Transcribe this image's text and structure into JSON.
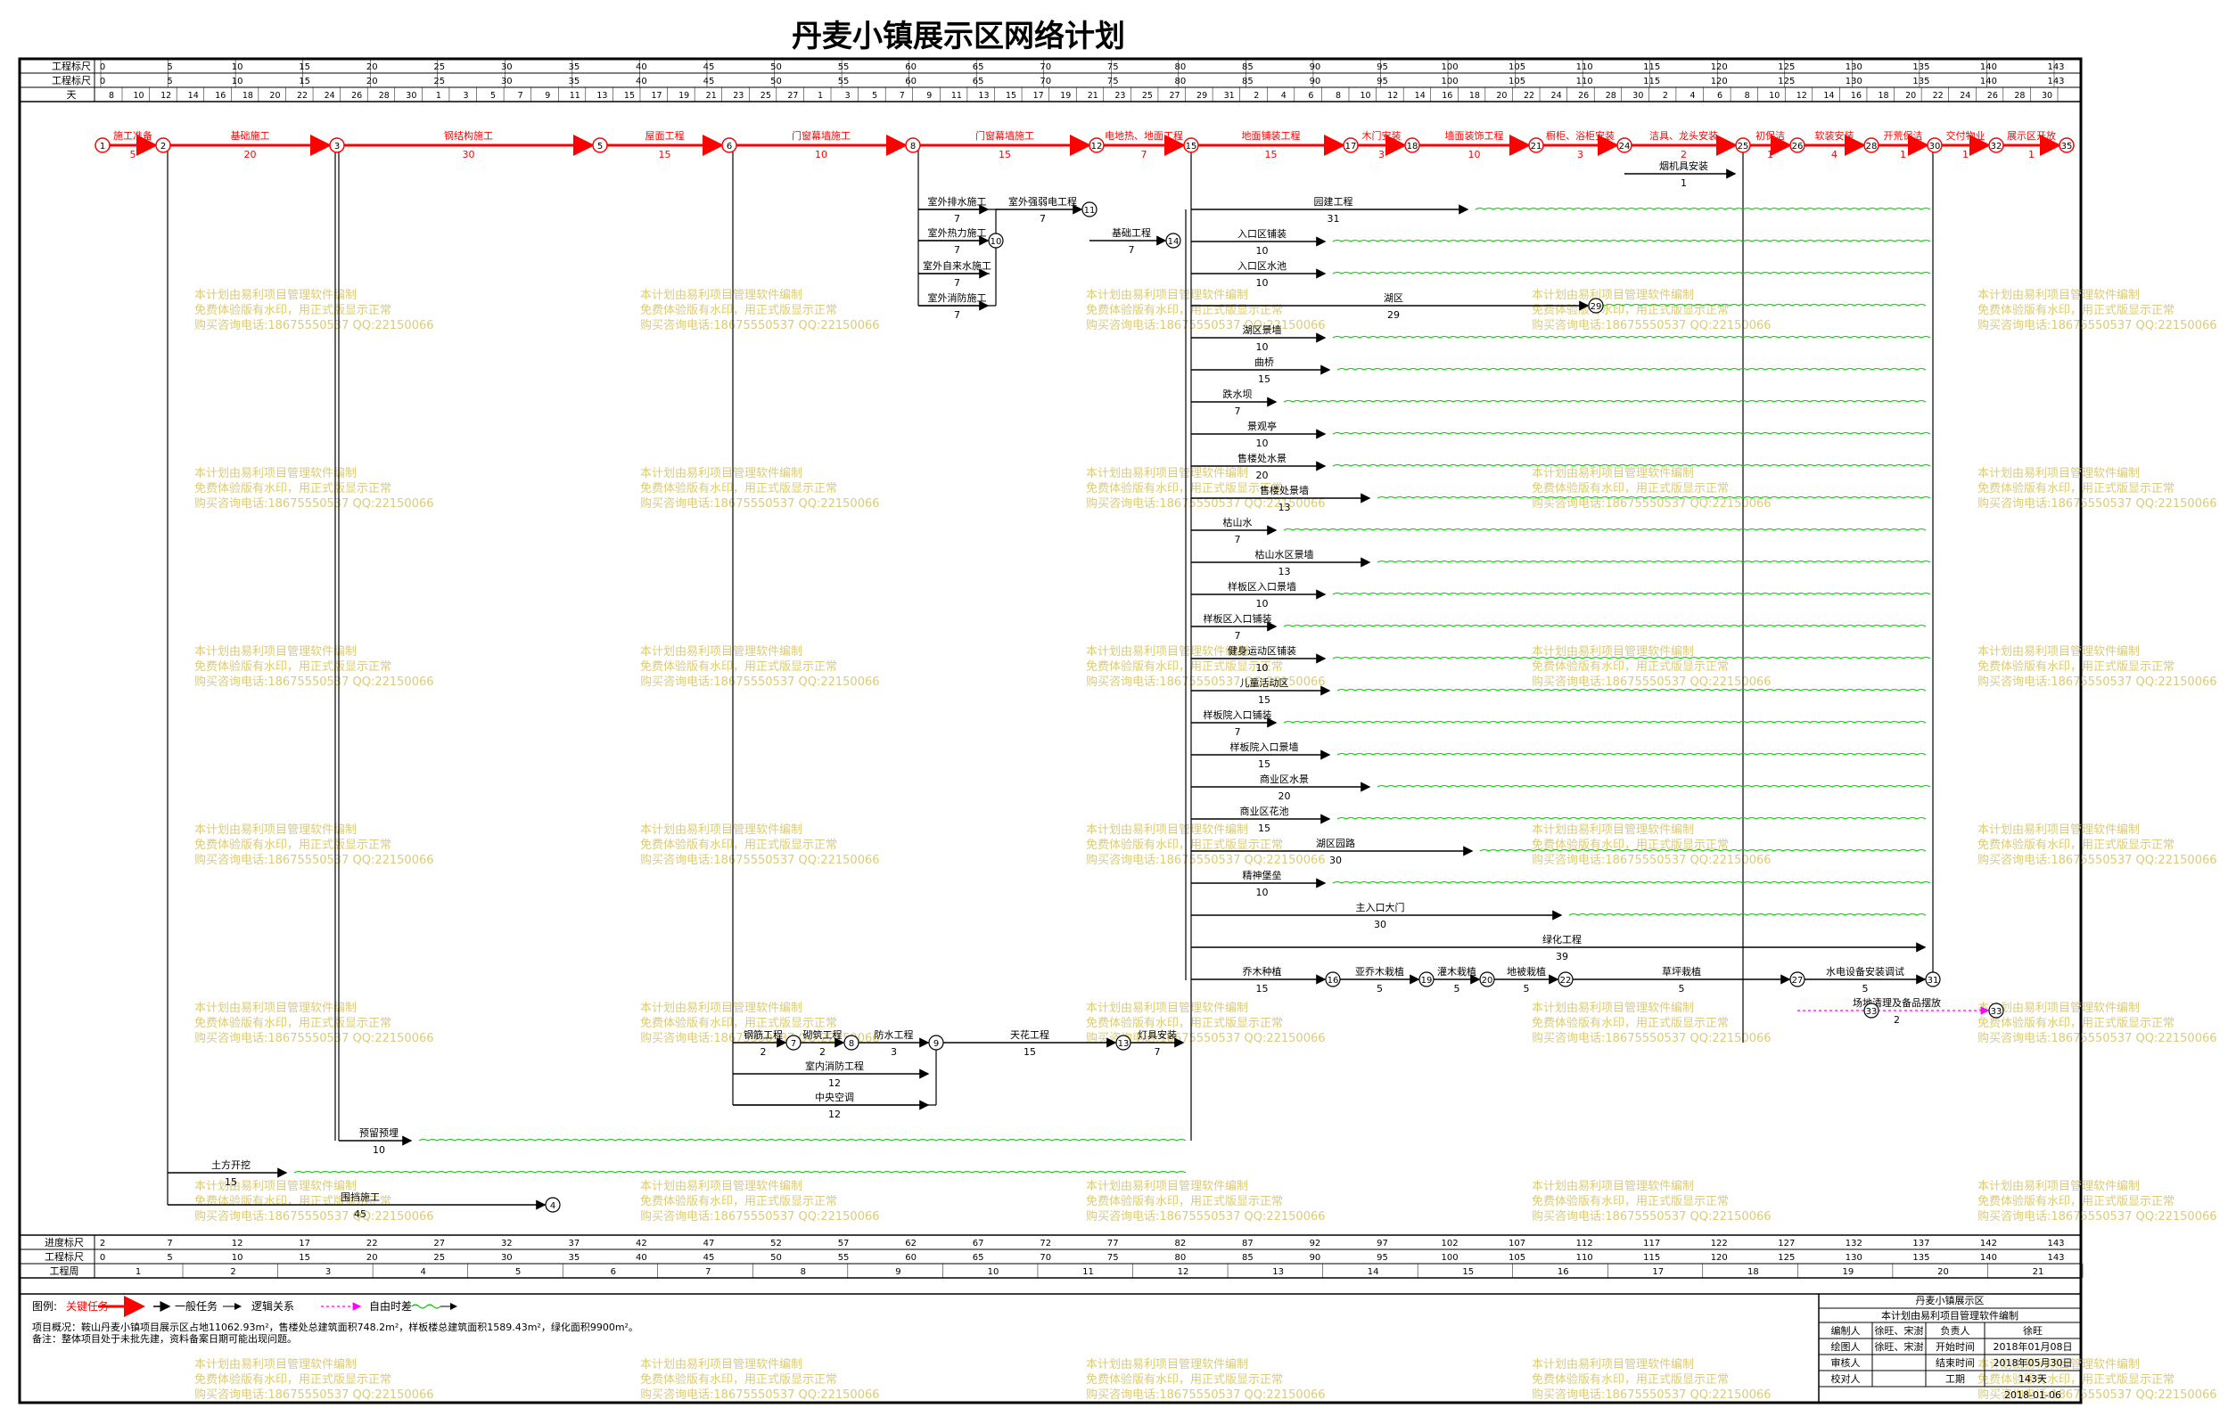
{
  "title": "丹麦小镇展示区网络计划",
  "ruler": {
    "top_row1_label": "工程标尺",
    "top_row2_label": "工程标尺",
    "top_row3_label": "天",
    "bottom_row1_label": "进度标尺",
    "bottom_row2_label": "工程标尺",
    "bottom_row3_label": "工程周",
    "ticks_top": [
      "0",
      "5",
      "10",
      "15",
      "20",
      "25",
      "30",
      "35",
      "40",
      "45",
      "50",
      "55",
      "60",
      "65",
      "70",
      "75",
      "80",
      "85",
      "90",
      "95",
      "100",
      "105",
      "110",
      "115",
      "120",
      "125",
      "130",
      "135",
      "140",
      "143"
    ],
    "days": [
      "8",
      "10",
      "12",
      "14",
      "16",
      "18",
      "20",
      "22",
      "24",
      "26",
      "28",
      "30",
      "1",
      "3",
      "5",
      "7",
      "9",
      "11",
      "13",
      "15",
      "17",
      "19",
      "21",
      "23",
      "25",
      "27",
      "1",
      "3",
      "5",
      "7",
      "9",
      "11",
      "13",
      "15",
      "17",
      "19",
      "21",
      "23",
      "25",
      "27",
      "29",
      "31",
      "2",
      "4",
      "6",
      "8",
      "10",
      "12",
      "14",
      "16",
      "18",
      "20",
      "22",
      "24",
      "26",
      "28",
      "30",
      "2",
      "4",
      "6",
      "8",
      "10",
      "12",
      "14",
      "16",
      "18",
      "20",
      "22",
      "24",
      "26",
      "28",
      "30"
    ],
    "bottom_ticks": [
      "2",
      "7",
      "12",
      "17",
      "22",
      "27",
      "32",
      "37",
      "42",
      "47",
      "52",
      "57",
      "62",
      "67",
      "72",
      "77",
      "82",
      "87",
      "92",
      "97",
      "102",
      "107",
      "112",
      "117",
      "122",
      "127",
      "132",
      "137",
      "142",
      "143"
    ],
    "weeks": [
      "1",
      "2",
      "3",
      "4",
      "5",
      "6",
      "7",
      "8",
      "9",
      "10",
      "11",
      "12",
      "13",
      "14",
      "15",
      "16",
      "17",
      "18",
      "19",
      "20",
      "21"
    ]
  },
  "critical_path": [
    {
      "node": "1",
      "label": "施工准备",
      "dur": "5"
    },
    {
      "node": "2",
      "label": "基础施工",
      "dur": "20"
    },
    {
      "node": "3",
      "label": "钢结构施工",
      "dur": "30"
    },
    {
      "node": "5",
      "label": "屋面工程",
      "dur": "15"
    },
    {
      "node": "6",
      "label": "门窗幕墙施工",
      "dur": "10"
    },
    {
      "node": "8",
      "label": "门窗幕墙施工",
      "dur": "15"
    },
    {
      "node": "12",
      "label": "电地热、地面工程",
      "dur": "7"
    },
    {
      "node": "15",
      "label": "地面铺装工程",
      "dur": "15"
    },
    {
      "node": "17",
      "label": "木门安装",
      "dur": "3"
    },
    {
      "node": "18",
      "label": "墙面装饰工程",
      "dur": "10"
    },
    {
      "node": "21",
      "label": "橱柜、浴柜安装",
      "dur": "3"
    },
    {
      "node": "24",
      "label": "洁具、龙头安装",
      "dur": "2"
    },
    {
      "node": "25",
      "label": "初保洁",
      "dur": "1"
    },
    {
      "node": "26",
      "label": "软装安装",
      "dur": "4"
    },
    {
      "node": "28",
      "label": "开荒保洁",
      "dur": "1"
    },
    {
      "node": "30",
      "label": "交付物业",
      "dur": "1"
    },
    {
      "node": "32",
      "label": "展示区开放",
      "dur": "1"
    },
    {
      "node": "35",
      "label": "",
      "dur": ""
    }
  ],
  "tasks": [
    {
      "label": "烟机具安装",
      "dur": "1"
    },
    {
      "label": "室外排水施工",
      "dur": "7"
    },
    {
      "label": "室外热力施工",
      "dur": "7"
    },
    {
      "label": "室外自来水施工",
      "dur": "7"
    },
    {
      "label": "室外消防施工",
      "dur": "7"
    },
    {
      "label": "室外强弱电工程",
      "dur": "7"
    },
    {
      "label": "基础工程",
      "dur": "7"
    },
    {
      "label": "园建工程",
      "dur": "31"
    },
    {
      "label": "入口区铺装",
      "dur": "10"
    },
    {
      "label": "入口区水池",
      "dur": "10"
    },
    {
      "label": "湖区",
      "dur": "29"
    },
    {
      "label": "湖区景墙",
      "dur": "10"
    },
    {
      "label": "曲桥",
      "dur": "15"
    },
    {
      "label": "跌水坝",
      "dur": "7"
    },
    {
      "label": "景观亭",
      "dur": "10"
    },
    {
      "label": "售楼处水景",
      "dur": "20"
    },
    {
      "label": "售楼处景墙",
      "dur": "13"
    },
    {
      "label": "枯山水",
      "dur": "7"
    },
    {
      "label": "枯山水区景墙",
      "dur": "13"
    },
    {
      "label": "样板区入口景墙",
      "dur": "10"
    },
    {
      "label": "样板区入口铺装",
      "dur": "7"
    },
    {
      "label": "健身运动区铺装",
      "dur": "10"
    },
    {
      "label": "儿童活动区",
      "dur": "15"
    },
    {
      "label": "样板院入口铺装",
      "dur": "7"
    },
    {
      "label": "样板院入口景墙",
      "dur": "15"
    },
    {
      "label": "商业区水景",
      "dur": "20"
    },
    {
      "label": "商业区花池",
      "dur": "15"
    },
    {
      "label": "湖区园路",
      "dur": "30"
    },
    {
      "label": "精神堡垒",
      "dur": "10"
    },
    {
      "label": "主入口大门",
      "dur": "30"
    },
    {
      "label": "绿化工程",
      "dur": "39"
    },
    {
      "label": "乔木种植",
      "dur": "15"
    },
    {
      "label": "亚乔木栽植",
      "dur": "5"
    },
    {
      "label": "灌木栽植",
      "dur": "5"
    },
    {
      "label": "地被栽植",
      "dur": "5"
    },
    {
      "label": "草坪栽植",
      "dur": "5"
    },
    {
      "label": "水电设备安装调试",
      "dur": "5"
    },
    {
      "label": "场地清理及备品摆放",
      "dur": "2"
    },
    {
      "label": "钢筋工程",
      "dur": "2"
    },
    {
      "label": "砌筑工程",
      "dur": "2"
    },
    {
      "label": "防水工程",
      "dur": "3"
    },
    {
      "label": "室内消防工程",
      "dur": "12"
    },
    {
      "label": "中央空调",
      "dur": "12"
    },
    {
      "label": "天花工程",
      "dur": "15"
    },
    {
      "label": "灯具安装",
      "dur": "7"
    },
    {
      "label": "预留预埋",
      "dur": "10"
    },
    {
      "label": "土方开挖",
      "dur": "15"
    },
    {
      "label": "围挡施工",
      "dur": "45"
    }
  ],
  "watermark": {
    "line1": "本计划由易利项目管理软件编制",
    "line2": "免费体验版有水印，用正式版显示正常",
    "line3": "购买咨询电话:18675550537 QQ:22150066"
  },
  "legend": {
    "label": "图例:",
    "critical": "关键任务",
    "normal": "一般任务",
    "logic": "逻辑关系",
    "freetime": "自由时差"
  },
  "notes": {
    "line1": "项目概况：鞍山丹麦小镇项目展示区占地11062.93m²，售楼处总建筑面积748.2m²，样板楼总建筑面积1589.43m²，绿化面积9900m²。",
    "line2": "备注：整体项目处于未批先建，资料备案日期可能出现问题。"
  },
  "info_table": {
    "heading": "丹麦小镇展示区",
    "subheading": "本计划由易利项目管理软件编制",
    "r1": [
      "编制人",
      "徐旺、宋澍",
      "负责人",
      "徐旺"
    ],
    "r2": [
      "绘图人",
      "徐旺、宋澍",
      "开始时间",
      "2018年01月08日"
    ],
    "r3": [
      "审核人",
      "",
      "结束时间",
      "2018年05月30日"
    ],
    "r4": [
      "校对人",
      "",
      "工期",
      "143天"
    ],
    "print_date": "2018-01-06"
  },
  "colors": {
    "critical": "#ff0000",
    "normal": "#000000",
    "freetime": "#00cc00",
    "dummy": "#ff00ff",
    "watermark": "#d6c35a"
  }
}
